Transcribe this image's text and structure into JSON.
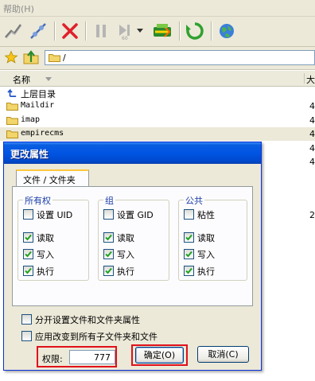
{
  "menu": {
    "help_label": "帮助(H)"
  },
  "toolbar": {
    "buttons": [
      {
        "icon": "connect-icon"
      },
      {
        "icon": "disconnect-icon"
      },
      {
        "icon": "stop-icon"
      },
      {
        "icon": "pause-icon"
      },
      {
        "icon": "skip-icon"
      },
      {
        "icon": "transfer-icon"
      },
      {
        "icon": "refresh-icon"
      },
      {
        "icon": "globe-icon"
      }
    ]
  },
  "address": {
    "path": "/"
  },
  "file_list": {
    "col_name": "名称",
    "col_size_partial": "大",
    "rows": [
      {
        "name": "上层目录",
        "size": ""
      },
      {
        "name": "Maildir",
        "size": "4"
      },
      {
        "name": "imap",
        "size": "4"
      },
      {
        "name": "empirecms",
        "size": "4"
      },
      {
        "name": "",
        "size": "4"
      },
      {
        "name": "",
        "size": "4"
      },
      {
        "name": "",
        "size": "2"
      }
    ]
  },
  "dialog": {
    "title": "更改属性",
    "tab_label": "文件 / 文件夹",
    "groups": {
      "owner": {
        "title": "所有权",
        "special_label": "设置 UID",
        "special_checked": false,
        "read_label": "读取",
        "read_checked": true,
        "write_label": "写入",
        "write_checked": true,
        "exec_label": "执行",
        "exec_checked": true
      },
      "group": {
        "title": "组",
        "special_label": "设置 GID",
        "special_checked": false,
        "read_label": "读取",
        "read_checked": true,
        "write_label": "写入",
        "write_checked": true,
        "exec_label": "执行",
        "exec_checked": true
      },
      "public": {
        "title": "公共",
        "special_label": "粘性",
        "special_checked": false,
        "read_label": "读取",
        "read_checked": true,
        "write_label": "写入",
        "write_checked": true,
        "exec_label": "执行",
        "exec_checked": true
      }
    },
    "options": {
      "separate_label": "分开设置文件和文件夹属性",
      "recursive_label": "应用改变到所有子文件夹和文件"
    },
    "permission": {
      "label": "权限:",
      "value": "777"
    },
    "ok_label": "确定(O)",
    "cancel_label": "取消(C)"
  },
  "colors": {
    "title_bar": "#0054e3",
    "highlight_box": "#e0101a",
    "group_title": "#1a3ea8"
  }
}
